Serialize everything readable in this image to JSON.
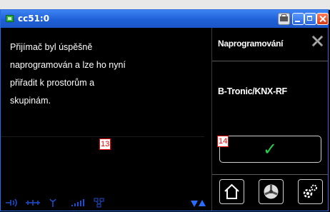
{
  "window": {
    "title": "cc51:0",
    "icons": [
      "app-icon",
      "printer-icon",
      "minimize-icon",
      "maximize-icon",
      "close-icon"
    ]
  },
  "left_panel": {
    "message_lines": [
      "Přijímač byl úspěšně",
      "naprogramován a lze ho nyní",
      "přiřadit k prostorům a",
      "skupinám."
    ],
    "marker": "13",
    "status_icons": [
      "signal-icon",
      "link-icon",
      "antenna-icon",
      "bars-icon",
      "network-icon"
    ],
    "scroll_arrows": [
      "arrow-down-icon",
      "arrow-up-icon"
    ]
  },
  "right_panel": {
    "title": "Naprogramování",
    "device": "B-Tronic/KNX-RF",
    "marker": "14",
    "confirm_icon": "checkmark-icon",
    "nav_icons": [
      "home-icon",
      "fan-icon",
      "gear-icon"
    ]
  },
  "colors": {
    "titlebar": "#1f5fd6",
    "check": "#2ad04a",
    "marker": "#ee0000",
    "status": "#1f4fd0"
  }
}
